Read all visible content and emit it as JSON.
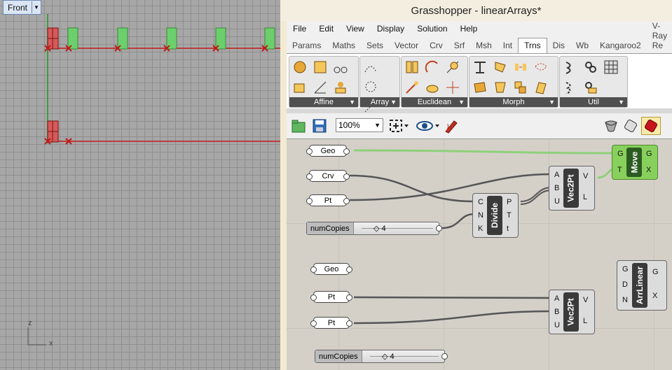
{
  "viewport": {
    "name": "Front",
    "axis_x": "x",
    "axis_z": "z"
  },
  "window": {
    "title": "Grasshopper - linearArrays*"
  },
  "menu": [
    "File",
    "Edit",
    "View",
    "Display",
    "Solution",
    "Help"
  ],
  "tabs": [
    {
      "label": "Params",
      "active": false
    },
    {
      "label": "Maths",
      "active": false
    },
    {
      "label": "Sets",
      "active": false
    },
    {
      "label": "Vector",
      "active": false
    },
    {
      "label": "Crv",
      "active": false
    },
    {
      "label": "Srf",
      "active": false
    },
    {
      "label": "Msh",
      "active": false
    },
    {
      "label": "Int",
      "active": false
    },
    {
      "label": "Trns",
      "active": true
    },
    {
      "label": "Dis",
      "active": false
    },
    {
      "label": "Wb",
      "active": false
    },
    {
      "label": "Kangaroo2",
      "active": false
    },
    {
      "label": "V-Ray Re",
      "active": false
    }
  ],
  "ribbon_groups": [
    "Affine",
    "Array",
    "Euclidean",
    "Morph",
    "Util"
  ],
  "toolbar": {
    "zoom": "100%"
  },
  "canvas": {
    "params": {
      "geo1": "Geo",
      "crv1": "Crv",
      "pt1": "Pt",
      "geo2": "Geo",
      "pt2": "Pt",
      "pt3": "Pt"
    },
    "sliders": {
      "s1_name": "numCopies",
      "s1_value": "4",
      "s2_name": "numCopies",
      "s2_value": "4"
    },
    "components": {
      "divide": {
        "name": "Divide",
        "inputs": [
          "C",
          "N",
          "K"
        ],
        "outputs": [
          "P",
          "T",
          "t"
        ]
      },
      "vec2pt1": {
        "name": "Vec2Pt",
        "inputs": [
          "A",
          "B",
          "U"
        ],
        "outputs": [
          "V",
          "L"
        ]
      },
      "move": {
        "name": "Move",
        "inputs": [
          "G",
          "T"
        ],
        "outputs": [
          "G",
          "X"
        ]
      },
      "vec2pt2": {
        "name": "Vec2Pt",
        "inputs": [
          "A",
          "B",
          "U"
        ],
        "outputs": [
          "V",
          "L"
        ]
      },
      "arrlinear": {
        "name": "ArrLinear",
        "inputs": [
          "G",
          "D",
          "N"
        ],
        "outputs": [
          "G",
          "X"
        ]
      }
    }
  }
}
